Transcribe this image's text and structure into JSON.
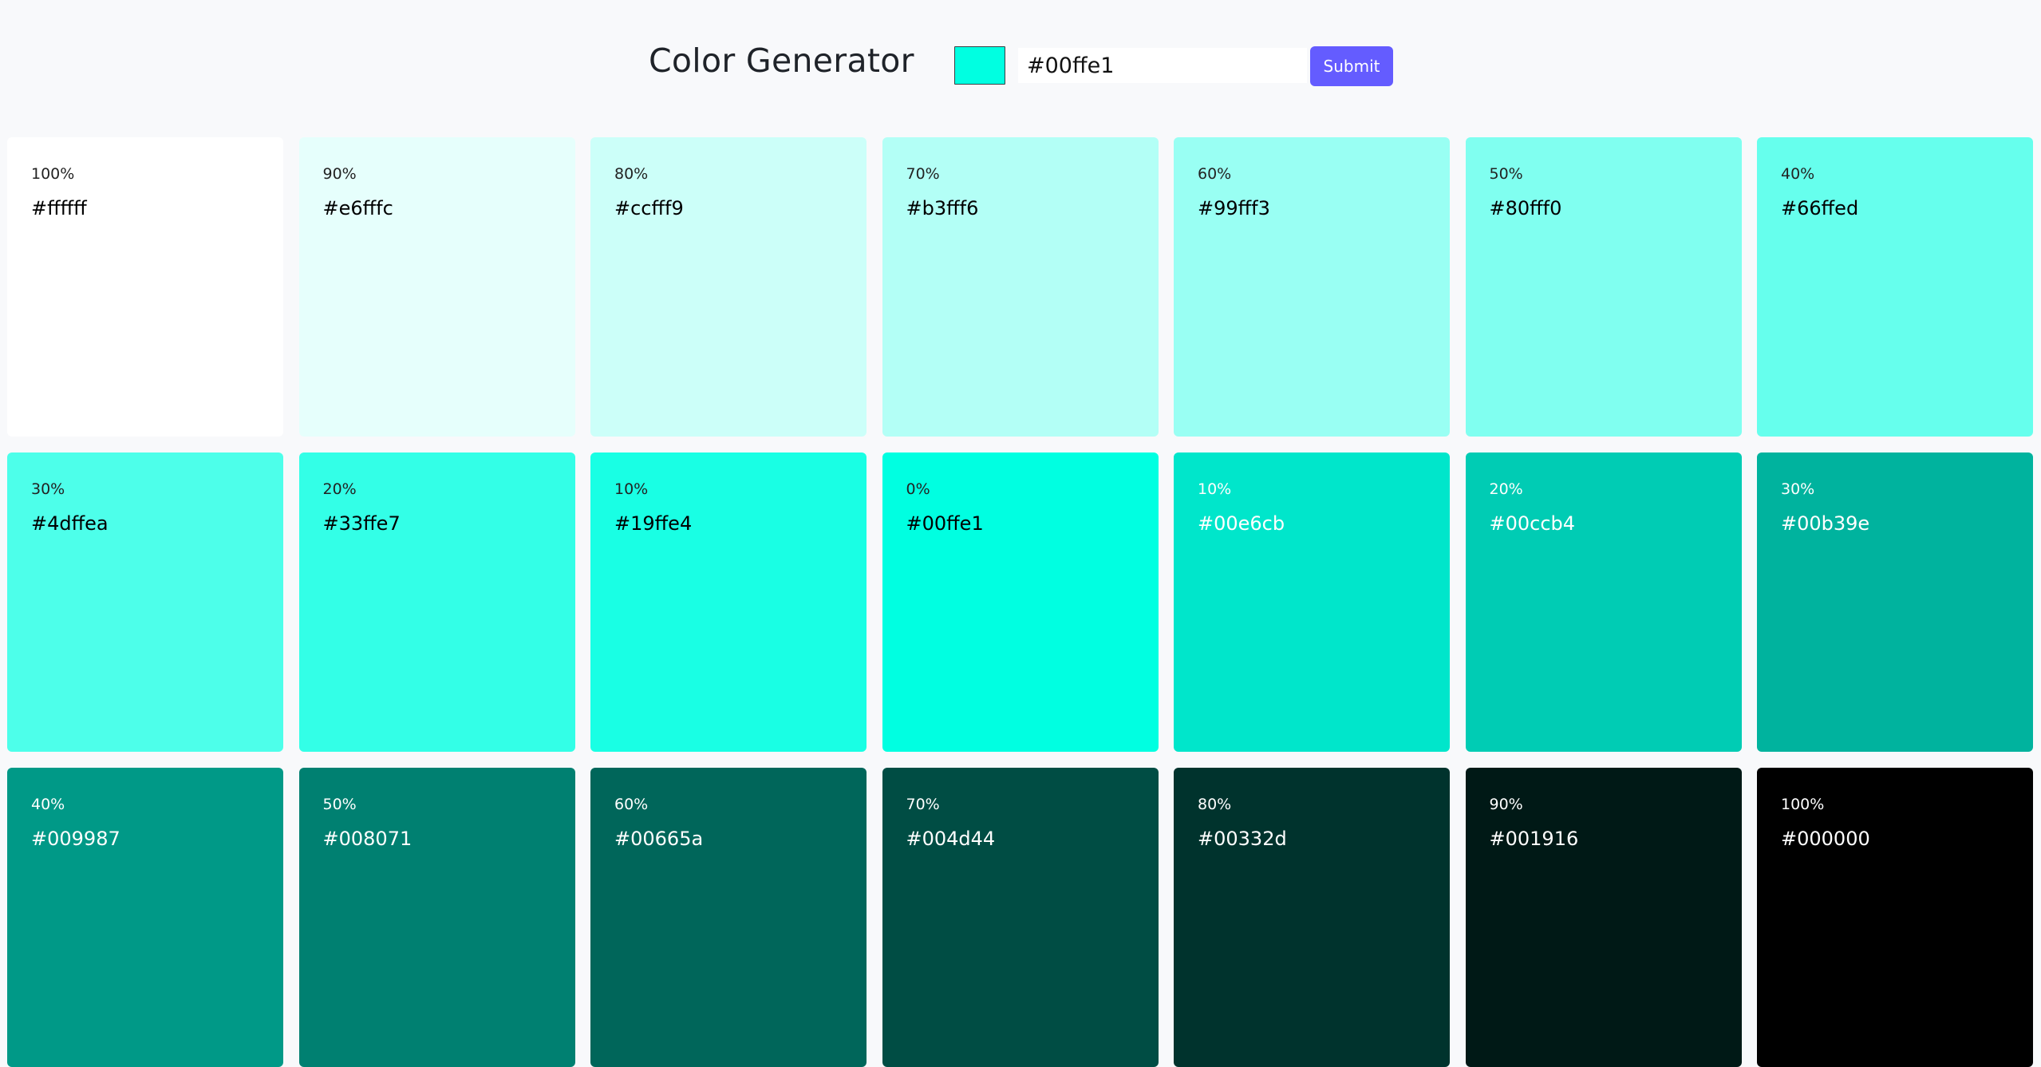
{
  "header": {
    "title": "Color Generator",
    "input_value": "#00ffe1",
    "picker_color": "#00ffe1",
    "submit_label": "Submit",
    "accent_color": "#645cff"
  },
  "swatches": [
    {
      "weight": "100%",
      "hex": "#ffffff",
      "text": "dark"
    },
    {
      "weight": "90%",
      "hex": "#e6fffc",
      "text": "dark"
    },
    {
      "weight": "80%",
      "hex": "#ccfff9",
      "text": "dark"
    },
    {
      "weight": "70%",
      "hex": "#b3fff6",
      "text": "dark"
    },
    {
      "weight": "60%",
      "hex": "#99fff3",
      "text": "dark"
    },
    {
      "weight": "50%",
      "hex": "#80fff0",
      "text": "dark"
    },
    {
      "weight": "40%",
      "hex": "#66ffed",
      "text": "dark"
    },
    {
      "weight": "30%",
      "hex": "#4dffea",
      "text": "dark"
    },
    {
      "weight": "20%",
      "hex": "#33ffe7",
      "text": "dark"
    },
    {
      "weight": "10%",
      "hex": "#19ffe4",
      "text": "dark"
    },
    {
      "weight": "0%",
      "hex": "#00ffe1",
      "text": "dark"
    },
    {
      "weight": "10%",
      "hex": "#00e6cb",
      "text": "light"
    },
    {
      "weight": "20%",
      "hex": "#00ccb4",
      "text": "light"
    },
    {
      "weight": "30%",
      "hex": "#00b39e",
      "text": "light"
    },
    {
      "weight": "40%",
      "hex": "#009987",
      "text": "light"
    },
    {
      "weight": "50%",
      "hex": "#008071",
      "text": "light"
    },
    {
      "weight": "60%",
      "hex": "#00665a",
      "text": "light"
    },
    {
      "weight": "70%",
      "hex": "#004d44",
      "text": "light"
    },
    {
      "weight": "80%",
      "hex": "#00332d",
      "text": "light"
    },
    {
      "weight": "90%",
      "hex": "#001916",
      "text": "light"
    },
    {
      "weight": "100%",
      "hex": "#000000",
      "text": "light"
    }
  ]
}
